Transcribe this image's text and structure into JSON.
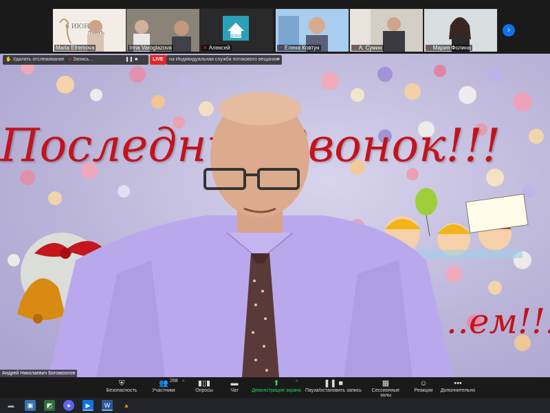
{
  "participants": [
    {
      "name": "Maria Efremova",
      "muted": false,
      "tile_text": "6 ИЮН... ДЕНЬ ...СКОГО ...А"
    },
    {
      "name": "Irina Varoglazova",
      "muted": false
    },
    {
      "name": "Алексей",
      "muted": true
    },
    {
      "name": "Елена Ковтун",
      "muted": true
    },
    {
      "name": "А. Сумин",
      "muted": true
    },
    {
      "name": "Мария Фолина",
      "muted": true
    }
  ],
  "top_controls": {
    "remove_tracking": "Удалить отслеживание",
    "record_label": "Запись...",
    "live_badge": "LIVE",
    "stream_label": "на Индивидуальная служба потокового вещания"
  },
  "stage": {
    "title": "Последний Звонок!!!",
    "subtitle": "…ем!!!",
    "speaker_name": "Андрей Николаевич Богомоолов"
  },
  "toolbar": {
    "security": "Безопасность",
    "participants": "Участники",
    "participants_count": "268",
    "polls": "Опросы",
    "chat": "Чат",
    "share_screen": "Демонстрация экрана",
    "pause_record": "Пауза/остановить запись",
    "breakout": "Сессионные залы",
    "reactions": "Реакции",
    "more": "Дополнительно"
  },
  "taskbar": {
    "apps": [
      "start",
      "store",
      "photos",
      "discord",
      "zoom",
      "word",
      "vlc"
    ]
  },
  "colors": {
    "accent": "#0e72ed",
    "live": "#e02828",
    "share_green": "#23d959",
    "title_red": "#c3131c"
  }
}
